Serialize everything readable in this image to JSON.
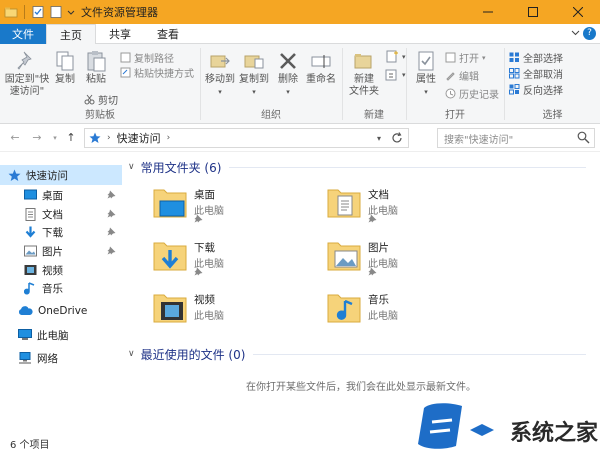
{
  "window": {
    "title": "文件资源管理器",
    "accent": "#f5a623"
  },
  "tabs": [
    {
      "label": "文件"
    },
    {
      "label": "主页"
    },
    {
      "label": "共享"
    },
    {
      "label": "查看"
    }
  ],
  "ribbon": {
    "clipboard": {
      "pin_label": "固定到\"快",
      "pin_label2": "速访问\"",
      "copy": "复制",
      "paste": "粘贴",
      "copy_path": "复制路径",
      "paste_shortcut": "粘贴快捷方式",
      "cut": "剪切",
      "group": "剪贴板"
    },
    "organize": {
      "move_to": "移动到",
      "copy_to": "复制到",
      "delete": "删除",
      "rename": "重命名",
      "group": "组织"
    },
    "new": {
      "new_folder": "新建",
      "new_folder2": "文件夹",
      "group": "新建"
    },
    "open": {
      "properties": "属性",
      "open": "打开",
      "edit": "编辑",
      "history": "历史记录",
      "group": "打开"
    },
    "select": {
      "select_all": "全部选择",
      "select_none": "全部取消",
      "invert": "反向选择",
      "group": "选择"
    }
  },
  "address": {
    "path": "快速访问",
    "search_placeholder": "搜索\"快速访问\""
  },
  "nav": {
    "items": [
      {
        "label": "快速访问"
      },
      {
        "label": "桌面"
      },
      {
        "label": "文档"
      },
      {
        "label": "下载"
      },
      {
        "label": "图片"
      },
      {
        "label": "视频"
      },
      {
        "label": "音乐"
      },
      {
        "label": "OneDrive"
      },
      {
        "label": "此电脑"
      },
      {
        "label": "网络"
      }
    ]
  },
  "content": {
    "frequent_header": "常用文件夹 (6)",
    "folders": [
      {
        "name": "桌面",
        "location": "此电脑"
      },
      {
        "name": "文档",
        "location": "此电脑"
      },
      {
        "name": "下载",
        "location": "此电脑"
      },
      {
        "name": "图片",
        "location": "此电脑"
      },
      {
        "name": "视频",
        "location": "此电脑"
      },
      {
        "name": "音乐",
        "location": "此电脑"
      }
    ],
    "recent_header": "最近使用的文件 (0)",
    "empty_message": "在你打开某些文件后，我们会在此处显示最新文件。"
  },
  "status": {
    "count": "6 个项目"
  },
  "watermark": {
    "text": "系统之家"
  }
}
